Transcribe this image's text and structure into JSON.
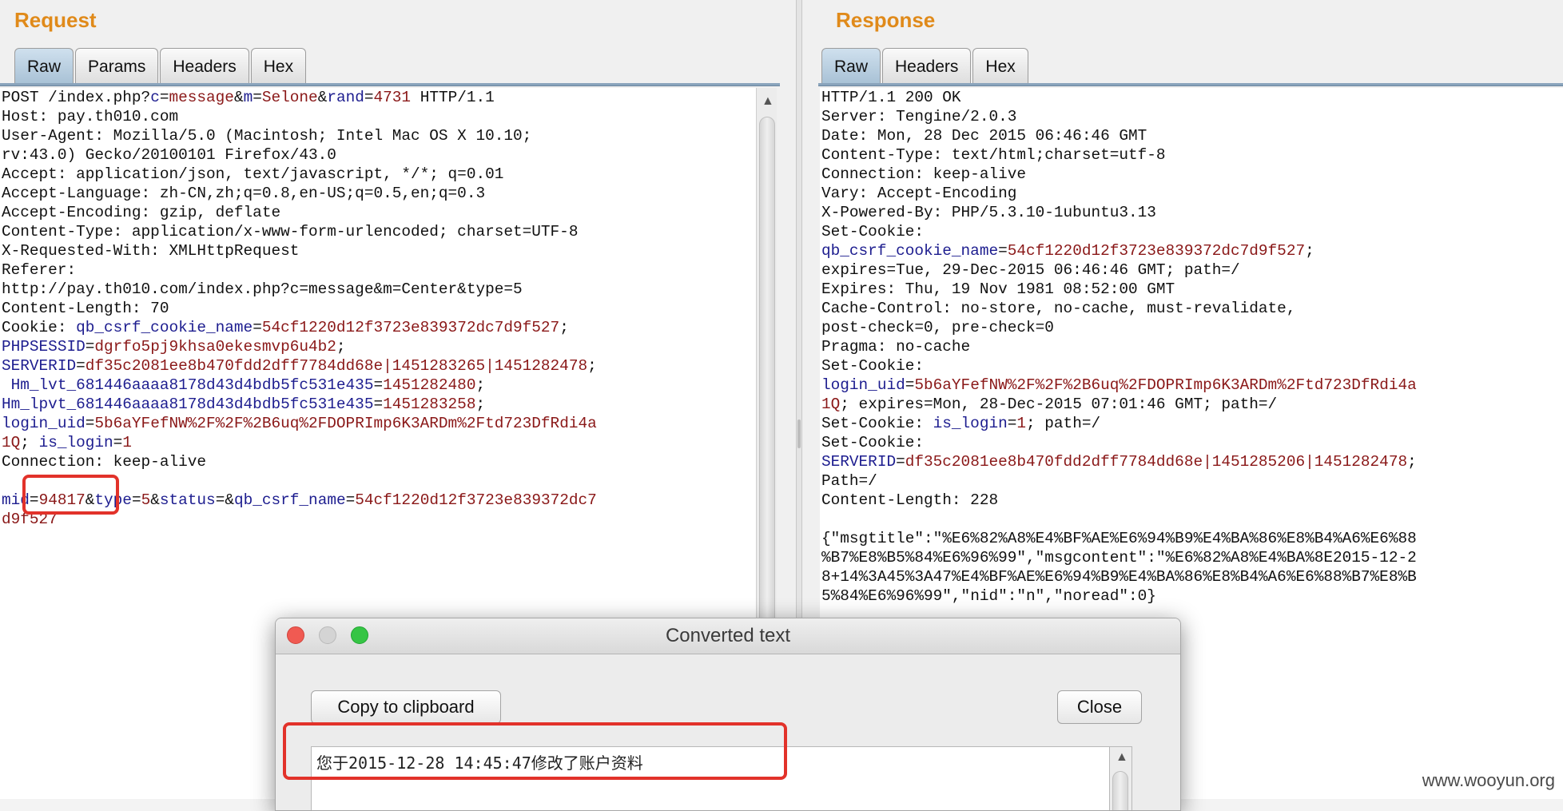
{
  "request": {
    "title": "Request",
    "tabs": [
      "Raw",
      "Params",
      "Headers",
      "Hex"
    ],
    "active_tab": "Raw",
    "lines": [
      [
        [
          "POST /index.php?",
          ""
        ],
        [
          "c",
          "k"
        ],
        [
          "=",
          ""
        ],
        [
          "message",
          "v"
        ],
        [
          "&",
          ""
        ],
        [
          "m",
          "k"
        ],
        [
          "=",
          ""
        ],
        [
          "Selone",
          "v"
        ],
        [
          "&",
          ""
        ],
        [
          "rand",
          "k"
        ],
        [
          "=",
          ""
        ],
        [
          "4731",
          "v"
        ],
        [
          " HTTP/1.1",
          ""
        ]
      ],
      [
        [
          "Host: pay.th010.com",
          ""
        ]
      ],
      [
        [
          "User-Agent: Mozilla/5.0 (Macintosh; Intel Mac OS X 10.10;",
          ""
        ]
      ],
      [
        [
          "rv:43.0) Gecko/20100101 Firefox/43.0",
          ""
        ]
      ],
      [
        [
          "Accept: application/json, text/javascript, */*; q=0.01",
          ""
        ]
      ],
      [
        [
          "Accept-Language: zh-CN,zh;q=0.8,en-US;q=0.5,en;q=0.3",
          ""
        ]
      ],
      [
        [
          "Accept-Encoding: gzip, deflate",
          ""
        ]
      ],
      [
        [
          "Content-Type: application/x-www-form-urlencoded; charset=UTF-8",
          ""
        ]
      ],
      [
        [
          "X-Requested-With: XMLHttpRequest",
          ""
        ]
      ],
      [
        [
          "Referer:",
          ""
        ]
      ],
      [
        [
          "http://pay.th010.com/index.php?c=message&m=Center&type=5",
          ""
        ]
      ],
      [
        [
          "Content-Length: 70",
          ""
        ]
      ],
      [
        [
          "Cookie: ",
          ""
        ],
        [
          "qb_csrf_cookie_name",
          "k"
        ],
        [
          "=",
          ""
        ],
        [
          "54cf1220d12f3723e839372dc7d9f527",
          "v"
        ],
        [
          ";",
          ""
        ]
      ],
      [
        [
          "PHPSESSID",
          "k"
        ],
        [
          "=",
          ""
        ],
        [
          "dgrfo5pj9khsa0ekesmvp6u4b2",
          "v"
        ],
        [
          ";",
          ""
        ]
      ],
      [
        [
          "SERVERID",
          "k"
        ],
        [
          "=",
          ""
        ],
        [
          "df35c2081ee8b470fdd2dff7784dd68e|1451283265|1451282478",
          "v"
        ],
        [
          ";",
          ""
        ]
      ],
      [
        [
          " Hm_lvt_681446aaaa8178d43d4bdb5fc531e435",
          "k"
        ],
        [
          "=",
          ""
        ],
        [
          "1451282480",
          "v"
        ],
        [
          ";",
          ""
        ]
      ],
      [
        [
          "Hm_lpvt_681446aaaa8178d43d4bdb5fc531e435",
          "k"
        ],
        [
          "=",
          ""
        ],
        [
          "1451283258",
          "v"
        ],
        [
          ";",
          ""
        ]
      ],
      [
        [
          "login_uid",
          "k"
        ],
        [
          "=",
          ""
        ],
        [
          "5b6aYFefNW%2F%2F%2B6uq%2FDOPRImp6K3ARDm%2Ftd723DfRdi4a",
          "v"
        ]
      ],
      [
        [
          "1Q",
          "v"
        ],
        [
          "; ",
          ""
        ],
        [
          "is_login",
          "k"
        ],
        [
          "=",
          ""
        ],
        [
          "1",
          "v"
        ]
      ],
      [
        [
          "Connection: keep-alive",
          ""
        ]
      ],
      [
        [
          "",
          ""
        ]
      ],
      [
        [
          "mid",
          "k"
        ],
        [
          "=",
          ""
        ],
        [
          "94817",
          "v"
        ],
        [
          "&",
          ""
        ],
        [
          "type",
          "k"
        ],
        [
          "=",
          ""
        ],
        [
          "5",
          "v"
        ],
        [
          "&",
          ""
        ],
        [
          "status",
          "k"
        ],
        [
          "=&",
          ""
        ],
        [
          "qb_csrf_name",
          "k"
        ],
        [
          "=",
          ""
        ],
        [
          "54cf1220d12f3723e839372dc7",
          "v"
        ]
      ],
      [
        [
          "d9f527",
          "v"
        ]
      ]
    ]
  },
  "response": {
    "title": "Response",
    "tabs": [
      "Raw",
      "Headers",
      "Hex"
    ],
    "active_tab": "Raw",
    "lines": [
      [
        [
          "HTTP/1.1 200 OK",
          ""
        ]
      ],
      [
        [
          "Server: Tengine/2.0.3",
          ""
        ]
      ],
      [
        [
          "Date: Mon, 28 Dec 2015 06:46:46 GMT",
          ""
        ]
      ],
      [
        [
          "Content-Type: text/html;charset=utf-8",
          ""
        ]
      ],
      [
        [
          "Connection: keep-alive",
          ""
        ]
      ],
      [
        [
          "Vary: Accept-Encoding",
          ""
        ]
      ],
      [
        [
          "X-Powered-By: PHP/5.3.10-1ubuntu3.13",
          ""
        ]
      ],
      [
        [
          "Set-Cookie:",
          ""
        ]
      ],
      [
        [
          "qb_csrf_cookie_name",
          "k"
        ],
        [
          "=",
          ""
        ],
        [
          "54cf1220d12f3723e839372dc7d9f527",
          "v"
        ],
        [
          ";",
          ""
        ]
      ],
      [
        [
          "expires=Tue, 29-Dec-2015 06:46:46 GMT; path=/",
          ""
        ]
      ],
      [
        [
          "Expires: Thu, 19 Nov 1981 08:52:00 GMT",
          ""
        ]
      ],
      [
        [
          "Cache-Control: no-store, no-cache, must-revalidate,",
          ""
        ]
      ],
      [
        [
          "post-check=0, pre-check=0",
          ""
        ]
      ],
      [
        [
          "Pragma: no-cache",
          ""
        ]
      ],
      [
        [
          "Set-Cookie:",
          ""
        ]
      ],
      [
        [
          "login_uid",
          "k"
        ],
        [
          "=",
          ""
        ],
        [
          "5b6aYFefNW%2F%2F%2B6uq%2FDOPRImp6K3ARDm%2Ftd723DfRdi4a",
          "v"
        ]
      ],
      [
        [
          "1Q",
          "v"
        ],
        [
          "; expires=Mon, 28-Dec-2015 07:01:46 GMT; path=/",
          ""
        ]
      ],
      [
        [
          "Set-Cookie: ",
          ""
        ],
        [
          "is_login",
          "k"
        ],
        [
          "=",
          ""
        ],
        [
          "1",
          "v"
        ],
        [
          "; path=/",
          ""
        ]
      ],
      [
        [
          "Set-Cookie:",
          ""
        ]
      ],
      [
        [
          "SERVERID",
          "k"
        ],
        [
          "=",
          ""
        ],
        [
          "df35c2081ee8b470fdd2dff7784dd68e|1451285206|1451282478",
          "v"
        ],
        [
          ";",
          ""
        ]
      ],
      [
        [
          "Path=/",
          ""
        ]
      ],
      [
        [
          "Content-Length: 228",
          ""
        ]
      ],
      [
        [
          "",
          ""
        ]
      ],
      [
        [
          "{\"msgtitle\":\"%E6%82%A8%E4%BF%AE%E6%94%B9%E4%BA%86%E8%B4%A6%E6%88",
          ""
        ]
      ],
      [
        [
          "%B7%E8%B5%84%E6%96%99\",\"msgcontent\":\"",
          ""
        ],
        [
          "%E6%82%A8%E4%BA%8E2015-12-2",
          "h"
        ]
      ],
      [
        [
          "8+14%3A45%3A47%E4%BF%AE%E6%94%B9%E4%BA%86%E8%B4%A6%E6%88%B7%E8%B",
          "h"
        ]
      ],
      [
        [
          "5%84%E6%96%99",
          "h"
        ],
        [
          "\",\"nid\":\"n\",\"noread\":0}",
          ""
        ]
      ]
    ]
  },
  "dialog": {
    "title": "Converted text",
    "copy_label": "Copy to clipboard",
    "close_label": "Close",
    "converted_text": "您于2015-12-28 14:45:47修改了账户资料"
  },
  "watermark": "www.wooyun.org",
  "colors": {
    "accent": "#e08a1a",
    "key": "#1d1d8f",
    "value": "#8a1818",
    "highlight": "#fbd49a",
    "annotation": "#e2322a"
  }
}
